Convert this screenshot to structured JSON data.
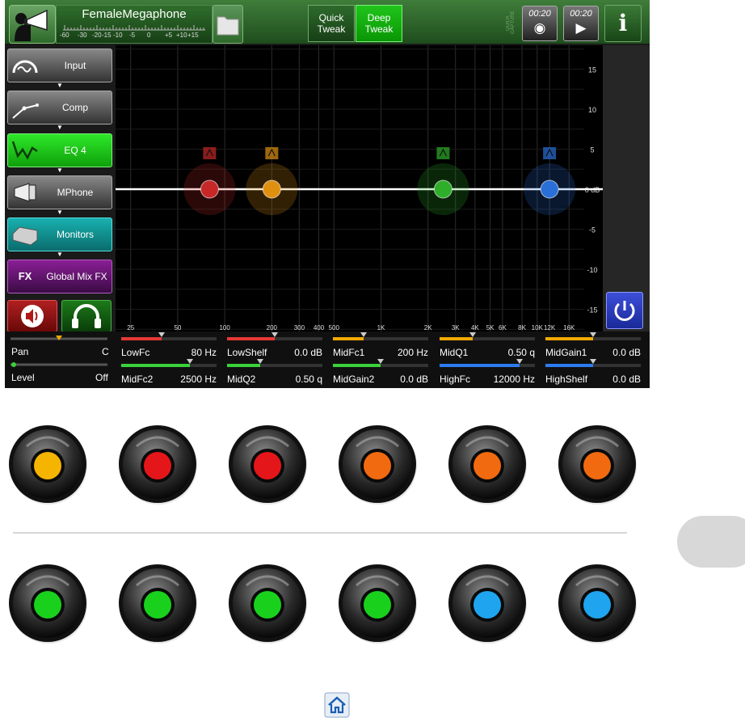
{
  "topbar": {
    "preset_name": "FemaleMegaphone",
    "meter_labels": [
      "-60",
      "-30",
      "-20",
      "-15",
      "-10",
      "-5",
      "0",
      "+5",
      "+10",
      "+15"
    ],
    "quick_tweak": "Quick\nTweak",
    "deep_tweak": "Deep\nTweak",
    "quick_capture": "QUICK CAPTURE",
    "record_time": "00:20",
    "play_time": "00:20",
    "info_label": "i"
  },
  "sidebar": {
    "blocks": [
      {
        "label": "Input",
        "icon": "input-gauge-icon"
      },
      {
        "label": "Comp",
        "icon": "compressor-curve-icon"
      },
      {
        "label": "EQ 4",
        "icon": "eq-curve-icon"
      },
      {
        "label": "MPhone",
        "icon": "megaphone-icon"
      },
      {
        "label": "Monitors",
        "icon": "monitor-speaker-icon"
      },
      {
        "label": "Global Mix FX",
        "icon": "fx-icon"
      }
    ],
    "fx_badge": "FX",
    "speaker_icon": "speaker-icon",
    "headphones_icon": "headphones-icon"
  },
  "eq": {
    "y_ticks": [
      "15",
      "10",
      "5",
      "0 dB",
      "-5",
      "-10",
      "-15"
    ],
    "x_ticks": [
      "25",
      "50",
      "100",
      "200",
      "300",
      "400",
      "500",
      "1K",
      "2K",
      "3K",
      "4K",
      "5K",
      "6K",
      "8K",
      "10K",
      "12K",
      "16K"
    ],
    "bands": [
      {
        "color": "#c62828",
        "type_icon": "low-cut-icon"
      },
      {
        "color": "#e09010",
        "type_icon": "peak-icon"
      },
      {
        "color": "#2fae2a",
        "type_icon": "peak-icon"
      },
      {
        "color": "#2a6fd8",
        "type_icon": "high-shelf-icon"
      }
    ]
  },
  "params": {
    "pan_label": "Pan",
    "pan_value": "C",
    "level_label": "Level",
    "level_value": "Off",
    "row1": [
      {
        "name": "LowFc",
        "value": "80 Hz",
        "color": "#e53935",
        "fill": 0.42
      },
      {
        "name": "LowShelf",
        "value": "0.0 dB",
        "color": "#e53935",
        "fill": 0.5
      },
      {
        "name": "MidFc1",
        "value": "200 Hz",
        "color": "#f2a900",
        "fill": 0.32
      },
      {
        "name": "MidQ1",
        "value": "0.50 q",
        "color": "#f2a900",
        "fill": 0.35
      },
      {
        "name": "MidGain1",
        "value": "0.0 dB",
        "color": "#f2a900",
        "fill": 0.5
      }
    ],
    "row2": [
      {
        "name": "MidFc2",
        "value": "2500 Hz",
        "color": "#3ad13a",
        "fill": 0.72
      },
      {
        "name": "MidQ2",
        "value": "0.50 q",
        "color": "#3ad13a",
        "fill": 0.35
      },
      {
        "name": "MidGain2",
        "value": "0.0 dB",
        "color": "#3ad13a",
        "fill": 0.5
      },
      {
        "name": "HighFc",
        "value": "12000 Hz",
        "color": "#2a7cf0",
        "fill": 0.84
      },
      {
        "name": "HighShelf",
        "value": "0.0 dB",
        "color": "#2a7cf0",
        "fill": 0.5
      }
    ]
  },
  "knobs": {
    "row1": [
      "#f5b400",
      "#e5161a",
      "#e5161a",
      "#f26a0f",
      "#f26a0f",
      "#f26a0f"
    ],
    "row2": [
      "#19d11c",
      "#19d11c",
      "#19d11c",
      "#19d11c",
      "#1fa4ef",
      "#1fa4ef"
    ]
  },
  "home_icon": "home-icon"
}
